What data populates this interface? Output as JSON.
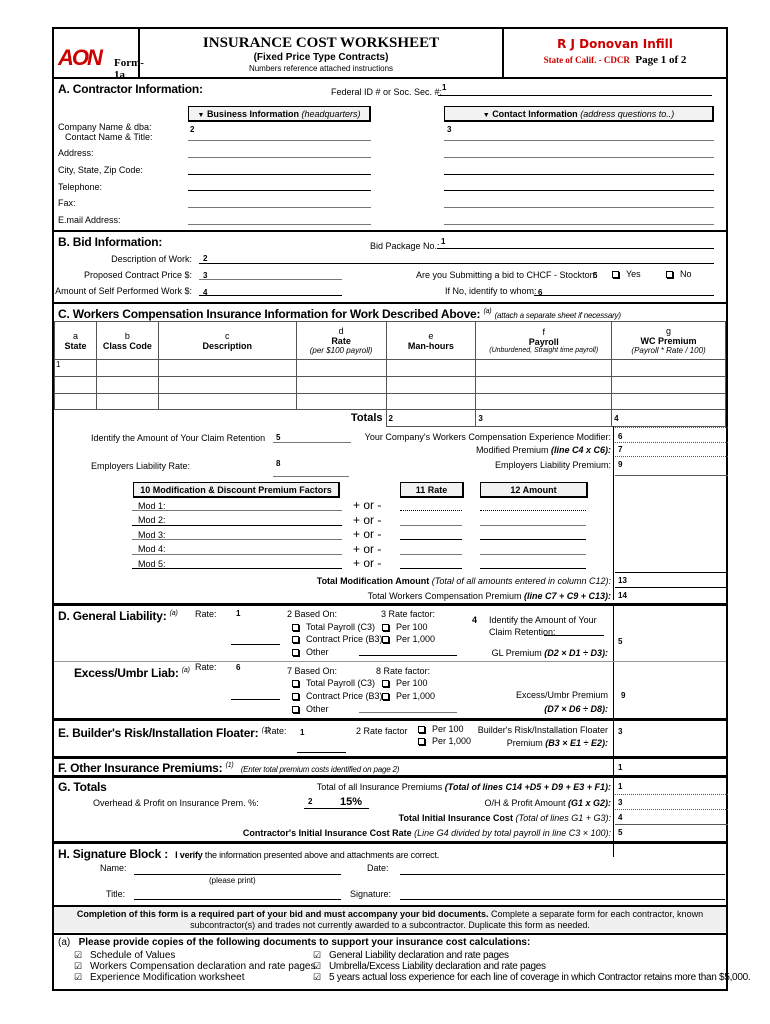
{
  "header": {
    "logo": "AON",
    "form_id": "Form-1a",
    "title": "INSURANCE COST WORKSHEET",
    "subtitle": "(Fixed Price Type Contracts)",
    "note": "Numbers reference attached instructions",
    "project": "R J Donovan Infill",
    "agency": "State of Calif. - CDCR",
    "page": "Page 1 of 2",
    "accent_color": "#cc0000"
  },
  "section_a": {
    "title": "A.  Contractor Information:",
    "federal_id_label": "Federal ID # or Soc. Sec. #:",
    "federal_id_num": "1",
    "business_header": "Business Information",
    "business_header_note": "(headquarters)",
    "contact_header": "Contact Information",
    "contact_header_note": "(address questions to..)",
    "business_num": "2",
    "contact_num": "3",
    "fields": [
      "Company Name & dba:",
      "Contact Name & Title:",
      "Address:",
      "City, State, Zip Code:",
      "Telephone:",
      "Fax:",
      "E.mail Address:"
    ]
  },
  "section_b": {
    "title": "B.  Bid  Information:",
    "bid_package_label": "Bid Package No.:",
    "bid_package_num": "1",
    "description_label": "Description of Work:",
    "description_num": "2",
    "contract_price_label": "Proposed Contract Price $:",
    "contract_price_num": "3",
    "self_performed_label": "Amount of Self Performed Work $:",
    "self_performed_num": "4",
    "chcf_question": "Are you Submitting a bid to CHCF - Stockton:",
    "chcf_num": "5",
    "yes_label": "Yes",
    "no_label": "No",
    "identify_label": "If No, identify to whom:",
    "identify_num": "6"
  },
  "section_c": {
    "title": "C.  Workers Compensation Insurance Information for Work Described Above:",
    "title_ref": "(a)",
    "title_note": "(attach a separate sheet if necessary)",
    "columns": [
      {
        "letter": "a",
        "label": "State",
        "sub": ""
      },
      {
        "letter": "b",
        "label": "Class Code",
        "sub": ""
      },
      {
        "letter": "c",
        "label": "Description",
        "sub": ""
      },
      {
        "letter": "d",
        "label": "Rate",
        "sub": "(per $100 payroll)"
      },
      {
        "letter": "e",
        "label": "Man-hours",
        "sub": ""
      },
      {
        "letter": "f",
        "label": "Payroll",
        "sub": "(Unburdened, Straight time payroll)"
      },
      {
        "letter": "g",
        "label": "WC Premium",
        "sub": "(Payroll * Rate / 100)"
      }
    ],
    "first_row_num": "1",
    "totals_label": "Totals",
    "totals_nums": [
      "2",
      "3",
      "4"
    ],
    "claim_retention_label": "Identify the Amount of Your Claim Retention",
    "claim_retention_num": "5",
    "experience_mod_label": "Your Company's Workers Compensation Experience Modifier:",
    "experience_mod_num": "6",
    "modified_premium_label": "Modified Premium",
    "modified_premium_formula": "(line  C4  x  C6):",
    "modified_premium_num": "7",
    "el_rate_label": "Employers Liability Rate:",
    "el_rate_num": "8",
    "el_premium_label": "Employers Liability Premium:",
    "el_premium_num": "9",
    "mod_factors_header": "10  Modification & Discount Premium Factors",
    "rate_header": "11 Rate",
    "amount_header": "12 Amount",
    "mods": [
      "Mod 1:",
      "Mod 2:",
      "Mod 3:",
      "Mod 4:",
      "Mod 5:"
    ],
    "plus_minus": "+ or  -",
    "total_mod_label": "Total Modification Amount",
    "total_mod_note": "(Total of all amounts entered in column C12):",
    "total_mod_num": "13",
    "total_wc_label": "Total Workers Compensation Premium",
    "total_wc_note": "(line C7 + C9 + C13):",
    "total_wc_num": "14"
  },
  "section_d": {
    "title": "D.  General Liability:",
    "title_ref": "(a)",
    "rate_label": "Rate:",
    "rate_num": "1",
    "based_on_label": "2 Based On:",
    "based_on_options": [
      "Total Payroll (C3)",
      "Contract Price (B3)",
      "Other"
    ],
    "rate_factor_label": "3  Rate factor:",
    "rate_factor_options": [
      "Per 100",
      "Per 1,000"
    ],
    "claim_num": "4",
    "claim_label_1": "Identify the Amount of Your",
    "claim_label_2": "Claim Retention:",
    "gl_premium_label": "GL Premium",
    "gl_premium_formula": "(D2 × D1 ÷ D3):",
    "gl_premium_num": "5",
    "excess_title": "Excess/Umbr Liab:",
    "excess_ref": "(a)",
    "excess_rate_label": "Rate:",
    "excess_rate_num": "6",
    "excess_based_on_label": "7 Based On:",
    "excess_rate_factor_label": "8  Rate factor:",
    "excess_premium_label": "Excess/Umbr Premium",
    "excess_premium_formula": "(D7 × D6 ÷ D8):",
    "excess_premium_num": "9"
  },
  "section_e": {
    "title": "E.  Builder's Risk/Installation Floater:",
    "title_ref": "(1)",
    "rate_label": "Rate:",
    "rate_num": "1",
    "rate_factor_label": "2  Rate factor",
    "rate_factor_options": [
      "Per 100",
      "Per 1,000"
    ],
    "premium_label_1": "Builder's Risk/Installation Floater",
    "premium_label_2": "Premium",
    "premium_formula": "(B3 × E1 ÷ E2):",
    "premium_num": "3"
  },
  "section_f": {
    "title": "F.  Other Insurance Premiums:",
    "title_ref": "(1)",
    "note": "(Enter total premium costs identified on page 2)",
    "num": "1"
  },
  "section_g": {
    "title": "G.  Totals",
    "total_premiums_label": "Total of all Insurance Premiums",
    "total_premiums_formula": "(Total of  lines C14 +D5 + D9 + E3 + F1):",
    "total_premiums_num": "1",
    "overhead_label": "Overhead & Profit on Insurance Prem. %:",
    "overhead_num": "2",
    "overhead_value": "15%",
    "oh_amount_label": "O/H & Profit Amount",
    "oh_amount_formula": "(G1 x G2):",
    "oh_amount_num": "3",
    "total_cost_label": "Total Initial Insurance Cost",
    "total_cost_formula": "(Total of lines G1 + G3):",
    "total_cost_num": "4",
    "cost_rate_label": "Contractor's Initial Insurance Cost Rate",
    "cost_rate_formula": "(Line G4 divided by total payroll in line C3  × 100):",
    "cost_rate_num": "5"
  },
  "section_h": {
    "title": "H.   Signature Block :",
    "verify_bold": "I verify",
    "verify_text": "the information presented above and attachments are correct.",
    "name_label": "Name:",
    "name_hint": "(please print)",
    "date_label": "Date:",
    "title_label": "Title:",
    "signature_label": "Signature:"
  },
  "notice": {
    "bold": "Completion of this form is a required part of your bid and must accompany your bid documents.",
    "text": "Complete a separate form for each contractor, known subcontractor(s) and trades not currently awarded to a subcontractor. Duplicate this form as needed."
  },
  "documents": {
    "ref": "(a)",
    "title": "Please provide copies of the following documents to support your insurance cost calculations:",
    "left": [
      "Schedule of Values",
      "Workers Compensation declaration and rate pages",
      "Experience Modification worksheet"
    ],
    "right": [
      "General Liability declaration and rate pages",
      "Umbrella/Excess Liability declaration and rate pages",
      "5 years actual loss experience for each line of coverage in which Contractor retains more than $5,000."
    ]
  }
}
